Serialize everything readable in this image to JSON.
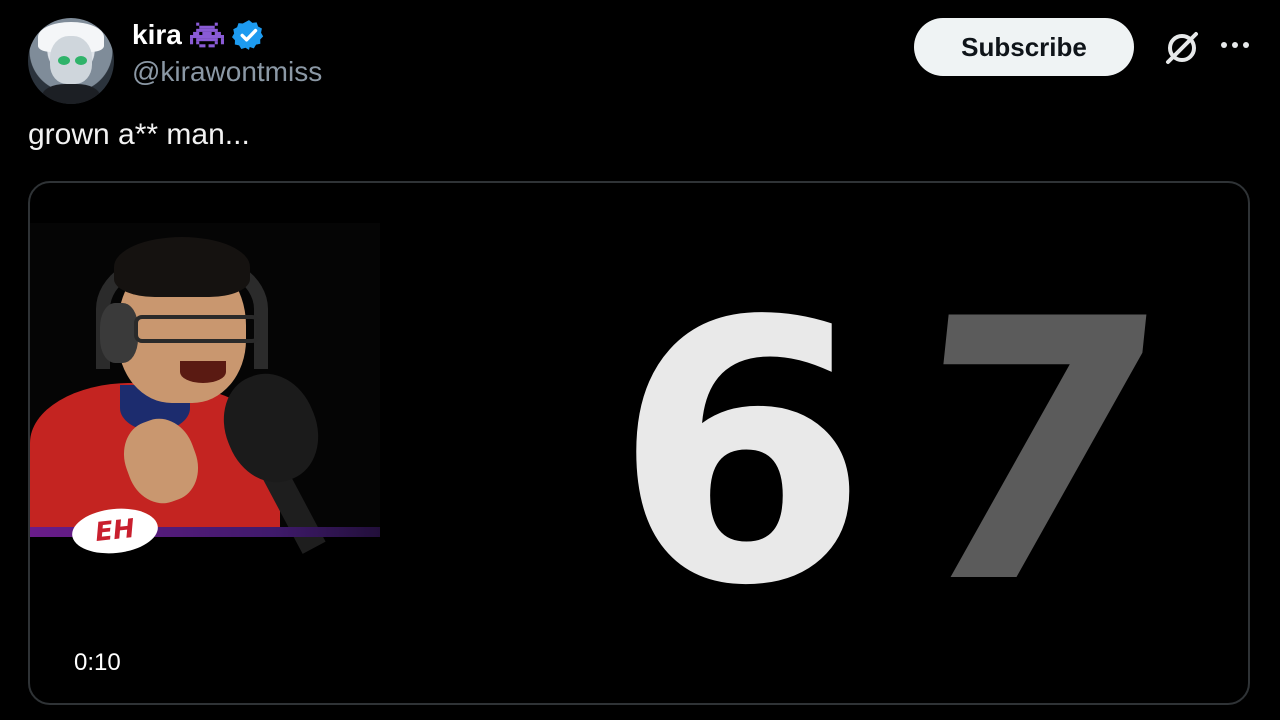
{
  "author": {
    "name": "kira",
    "handle": "@kirawontmiss",
    "verified": true,
    "name_emoji_icon": "alien-monster-icon",
    "verified_color": "#1d9bf0"
  },
  "actions": {
    "subscribe_label": "Subscribe",
    "grok_icon": "grok-icon",
    "more_icon": "more-icon"
  },
  "tweet": {
    "text": "grown a** man..."
  },
  "media": {
    "type": "video",
    "overlay_digits": [
      "6",
      "7"
    ],
    "channel_logo_text": "EH",
    "timestamp": "0:10"
  },
  "colors": {
    "background": "#000000",
    "subscribe_bg": "#eff3f4",
    "handle": "#8b98a5",
    "accent_purple": "#6a1c8a"
  }
}
